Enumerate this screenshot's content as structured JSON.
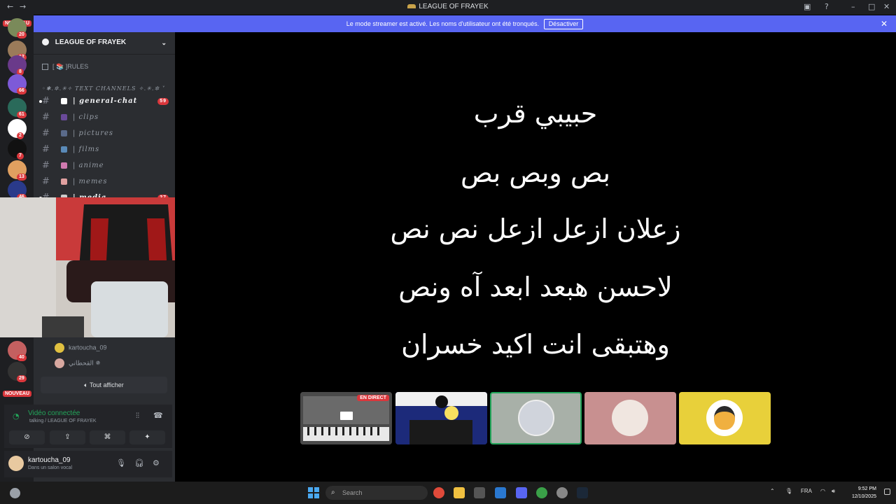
{
  "window": {
    "title": "LEAGUE OF FRAYEK",
    "back": "←",
    "forward": "→"
  },
  "banner": {
    "message": "Le mode streamer est activé. Les noms d'utilisateur ont été tronqués.",
    "action_label": "Désactiver",
    "close": "✕"
  },
  "guilds": {
    "nouveau_top": "NOUVEAU",
    "nouveau_bottom": "NOUVEAU",
    "items": [
      {
        "badge": "20",
        "color": "#7a8a5a"
      },
      {
        "badge": "12",
        "color": "#9b7b5a"
      },
      {
        "badge": "8",
        "color": "#6a3a8a"
      },
      {
        "badge": "66",
        "color": "#7d5ad8"
      },
      {
        "badge": "61",
        "color": "#2a6a5a"
      },
      {
        "badge": "2",
        "color": "#ffffff"
      },
      {
        "badge": "7",
        "color": "#111111"
      },
      {
        "badge": "13",
        "color": "#e0a060"
      },
      {
        "badge": "46",
        "color": "#2a3a8a"
      },
      {
        "badge": "40",
        "color": "#c46060"
      },
      {
        "badge": "29",
        "color": "#333333"
      }
    ]
  },
  "sidebar": {
    "server_name": "LEAGUE OF FRAYEK",
    "rules_label": "[ 📚 ]RULES",
    "category_label": "◦✱.✲.✳✧ TEXT CHANNELS ✧.✳.✲ ˅",
    "channels": [
      {
        "name": "general-chat",
        "count": "59",
        "active": true,
        "icon_color": "#ffffff"
      },
      {
        "name": "clips",
        "count": "",
        "active": false,
        "icon_color": "#6a4a9a"
      },
      {
        "name": "pictures",
        "count": "",
        "active": false,
        "icon_color": "#5a6a8a"
      },
      {
        "name": "films",
        "count": "",
        "active": false,
        "icon_color": "#5a8ab8"
      },
      {
        "name": "anime",
        "count": "",
        "active": false,
        "icon_color": "#d07ab0"
      },
      {
        "name": "memes",
        "count": "",
        "active": false,
        "icon_color": "#e0a0a0"
      },
      {
        "name": "media",
        "count": "27",
        "active": true,
        "icon_color": "#cccccc"
      }
    ],
    "voice_users": [
      {
        "name": "kartoucha_09",
        "color": "#e0c040"
      },
      {
        "name": "القحطاني ✵",
        "color": "#d8a8a0"
      }
    ],
    "show_all_label": "Tout afficher",
    "voice_panel": {
      "title": "Vidéo connectée",
      "subtitle": "talking / LEAGUE OF FRAYEK"
    },
    "user": {
      "name": "kartoucha_09",
      "status": "Dans un salon vocal"
    }
  },
  "stage": {
    "lyrics": [
      "حبيبي قرب",
      "بص وبص بص",
      "زعلان ازعل ازعل نص نص",
      "لاحسن هبعد ابعد آه ونص",
      "وهتبقى انت اكيد خسران"
    ],
    "live_label": "EN DIRECT"
  },
  "taskbar": {
    "search_placeholder": "Search",
    "language": "FRA",
    "time": "9:52 PM",
    "date": "12/10/2025"
  }
}
